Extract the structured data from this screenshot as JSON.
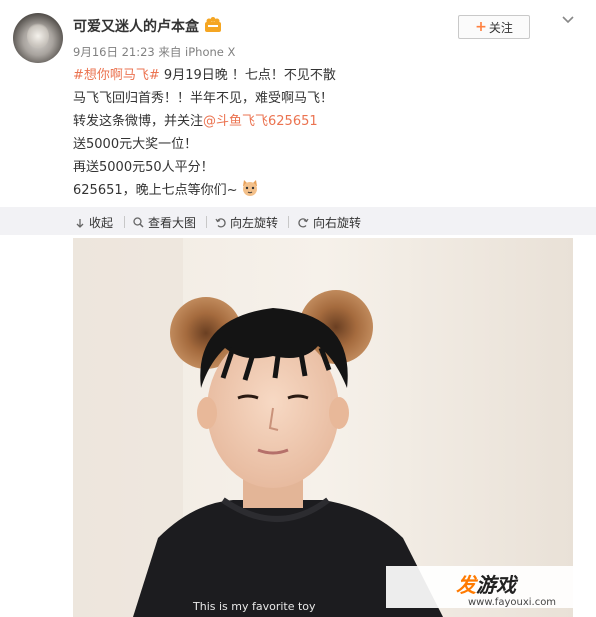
{
  "user": {
    "name": "可爱又迷人的卢本盒",
    "meta": "9月16日 21:23 来自 iPhone X"
  },
  "follow": {
    "label": "关注"
  },
  "post": {
    "hashtag": "#想你啊马飞#",
    "line1_rest": " 9月19日晚 ！七点！不见不散",
    "line2": "马飞飞回归首秀！！半年不见，难受啊马飞！",
    "line3_prefix": "转发这条微博，并关注",
    "mention": "@斗鱼飞飞625651",
    "line4": "送5000元大奖一位！",
    "line5": "再送5000元50人平分！",
    "line6": "625651，晚上七点等你们~"
  },
  "toolbar": {
    "collapse": "收起",
    "view_large": "查看大图",
    "rotate_left": "向左旋转",
    "rotate_right": "向右旋转"
  },
  "photo": {
    "shirt_text": "This is my favorite toy"
  },
  "watermark": {
    "brand_orange": "发",
    "brand_rest": "游戏",
    "url": "www.fayouxi.com"
  },
  "colors": {
    "link": "#eb7350",
    "follow_plus": "#ff8140",
    "toolbar_bg": "#f2f2f5"
  }
}
